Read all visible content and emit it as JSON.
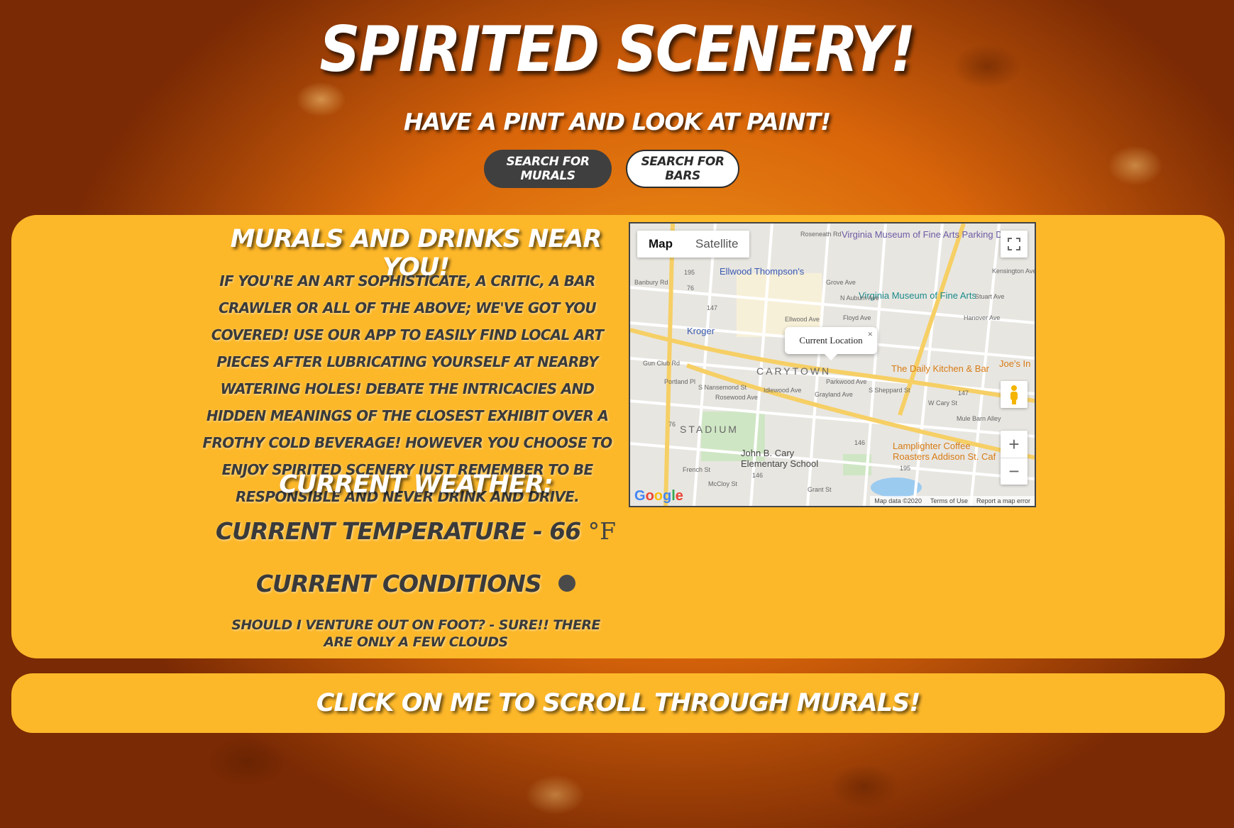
{
  "header": {
    "title": "Spirited Scenery!",
    "tagline": "Have a pint and look at paint!",
    "buttons": {
      "murals": "Search for Murals",
      "bars": "Search for Bars"
    }
  },
  "panel": {
    "title": "Murals and Drinks near you!",
    "description": "If you're an art sophisticate, a critic, a bar crawler or all of the above; We've got you covered! Use our app to easily find local art pieces after lubricating yourself at nearby watering holes! Debate the intricacies and hidden meanings of the closest exhibit over a frothy cold beverage! However you choose to enjoy Spirited Scenery just remember to be responsible and never drink and drive.",
    "weather_title": "Current Weather:",
    "temperature_label": "Current Temperature - 66",
    "temperature_unit": "°F",
    "conditions_label": "Current Conditions",
    "conditions_icon": "cloud-icon",
    "venture_text": "Should I venture out on foot? - Sure!! There are only a few clouds"
  },
  "map": {
    "toggle": {
      "map": "Map",
      "satellite": "Satellite"
    },
    "popup": "Current Location",
    "popup_close": "×",
    "pois": {
      "vmfa_parking": "Virginia Museum of Fine Arts Parking Deck",
      "ellwood": "Ellwood Thompson's",
      "vmfa": "Virginia Museum of Fine Arts",
      "kroger": "Kroger",
      "carytown": "CARYTOWN",
      "daily_kitchen": "The Daily Kitchen & Bar",
      "joes": "Joe's In",
      "stadium": "STADIUM",
      "john_b_cary": "John B. Cary Elementary School",
      "lamplighter": "Lamplighter Coffee Roasters Addison St. Caf"
    },
    "streets": [
      "Ellwood Ave",
      "Floyd Ave",
      "Grove Ave",
      "Kensington Ave",
      "Stuart Ave",
      "Hanover Ave",
      "Parkwood Ave",
      "Grayland Ave",
      "W Cary St",
      "Idlewood Ave",
      "Rosewood Ave",
      "French St",
      "McCloy St",
      "Mule Barn Alley",
      "S Sheppard St",
      "N Auburn Ave",
      "Roseneath Rd",
      "Gun Club Rd",
      "Portland Pl",
      "Banbury Rd",
      "S Nansemond St",
      "Grant St"
    ],
    "route_shields": [
      "195",
      "76",
      "147",
      "147",
      "76",
      "146",
      "146",
      "195"
    ],
    "footer": {
      "data": "Map data ©2020",
      "terms": "Terms of Use",
      "report": "Report a map error"
    },
    "logo": "Google"
  },
  "scroll_bar": {
    "label": "Click on me to scroll through murals!"
  }
}
